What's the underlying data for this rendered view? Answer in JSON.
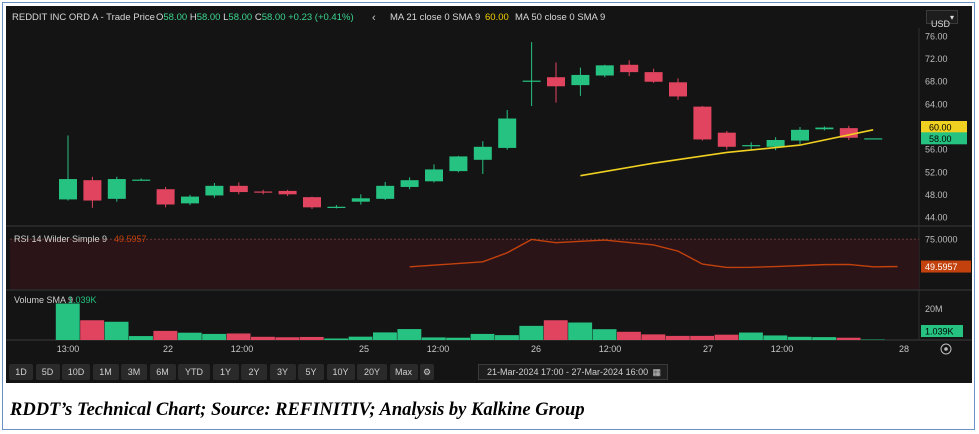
{
  "header": {
    "instrument": "REDDIT INC ORD A - Trade Price",
    "o_label": "O",
    "o_value": "58.00",
    "h_label": "H",
    "h_value": "58.00",
    "l_label": "L",
    "l_value": "58.00",
    "c_label": "C",
    "c_value": "58.00",
    "change": "+0.23 (+0.41%)",
    "chevron": "‹",
    "ma_label": "MA 21 close 0 SMA 9",
    "ma_value": "60.00",
    "ma50_label": "MA 50 close 0 SMA 9",
    "currency": "USD"
  },
  "colors": {
    "up": "#26c281",
    "down": "#e0445f",
    "ma": "#f0d020",
    "rsi": "#c2410c",
    "background": "#141414"
  },
  "chart_data": {
    "type": "candlestick",
    "price_axis": {
      "ticks": [
        "76.00",
        "72.00",
        "68.00",
        "64.00",
        "60.00",
        "56.00",
        "52.00",
        "48.00",
        "44.00"
      ],
      "ylim": [
        42.5,
        77.5
      ]
    },
    "price_badges": [
      {
        "label": "60.00",
        "value": 60.0,
        "color": "#f0d020"
      },
      {
        "label": "58.00",
        "value": 58.0,
        "color": "#26c281"
      }
    ],
    "time_labels": [
      "13:00",
      "22",
      "12:00",
      "25",
      "12:00",
      "26",
      "12:00",
      "27",
      "12:00",
      "28"
    ],
    "candles": [
      {
        "o": 47.2,
        "h": 58.5,
        "l": 47.0,
        "c": 50.8
      },
      {
        "o": 50.6,
        "h": 51.2,
        "l": 45.7,
        "c": 47.0
      },
      {
        "o": 47.3,
        "h": 51.2,
        "l": 46.8,
        "c": 50.8
      },
      {
        "o": 50.7,
        "h": 50.9,
        "l": 50.5,
        "c": 50.7
      },
      {
        "o": 49.0,
        "h": 49.4,
        "l": 45.8,
        "c": 46.3
      },
      {
        "o": 46.5,
        "h": 48.0,
        "l": 46.2,
        "c": 47.7
      },
      {
        "o": 47.9,
        "h": 50.1,
        "l": 47.5,
        "c": 49.6
      },
      {
        "o": 49.6,
        "h": 50.2,
        "l": 48.1,
        "c": 48.5
      },
      {
        "o": 48.6,
        "h": 48.9,
        "l": 48.1,
        "c": 48.4
      },
      {
        "o": 48.7,
        "h": 48.9,
        "l": 47.8,
        "c": 48.1
      },
      {
        "o": 47.6,
        "h": 47.7,
        "l": 45.5,
        "c": 45.8
      },
      {
        "o": 45.9,
        "h": 46.2,
        "l": 45.6,
        "c": 45.9
      },
      {
        "o": 46.8,
        "h": 48.1,
        "l": 46.3,
        "c": 47.4
      },
      {
        "o": 47.3,
        "h": 50.3,
        "l": 47.1,
        "c": 49.6
      },
      {
        "o": 49.4,
        "h": 51.1,
        "l": 49.0,
        "c": 50.6
      },
      {
        "o": 50.4,
        "h": 53.4,
        "l": 50.2,
        "c": 52.5
      },
      {
        "o": 52.2,
        "h": 54.9,
        "l": 52.0,
        "c": 54.8
      },
      {
        "o": 54.2,
        "h": 57.5,
        "l": 51.7,
        "c": 56.5
      },
      {
        "o": 56.3,
        "h": 63.0,
        "l": 56.0,
        "c": 61.5
      },
      {
        "o": 68.0,
        "h": 75.0,
        "l": 63.7,
        "c": 68.2
      },
      {
        "o": 68.8,
        "h": 71.4,
        "l": 64.3,
        "c": 67.2
      },
      {
        "o": 67.4,
        "h": 70.5,
        "l": 65.5,
        "c": 69.2
      },
      {
        "o": 69.1,
        "h": 71.0,
        "l": 68.8,
        "c": 70.9
      },
      {
        "o": 71.0,
        "h": 71.8,
        "l": 69.0,
        "c": 69.7
      },
      {
        "o": 69.7,
        "h": 70.3,
        "l": 67.8,
        "c": 68.0
      },
      {
        "o": 67.9,
        "h": 68.6,
        "l": 64.8,
        "c": 65.4
      },
      {
        "o": 63.6,
        "h": 63.7,
        "l": 57.6,
        "c": 57.8
      },
      {
        "o": 59.0,
        "h": 59.3,
        "l": 56.0,
        "c": 56.5
      },
      {
        "o": 56.6,
        "h": 57.3,
        "l": 56.0,
        "c": 56.8
      },
      {
        "o": 56.5,
        "h": 58.2,
        "l": 55.9,
        "c": 57.7
      },
      {
        "o": 57.6,
        "h": 60.0,
        "l": 57.0,
        "c": 59.5
      },
      {
        "o": 59.6,
        "h": 60.1,
        "l": 59.4,
        "c": 59.9
      },
      {
        "o": 59.8,
        "h": 60.2,
        "l": 57.7,
        "c": 58.1
      },
      {
        "o": 58.0,
        "h": 58.0,
        "l": 58.0,
        "c": 58.0
      }
    ],
    "ma_line": [
      [
        21,
        51.4
      ],
      [
        24,
        53.6
      ],
      [
        27,
        55.5
      ],
      [
        30,
        56.8
      ],
      [
        33,
        59.5
      ]
    ],
    "rsi": {
      "label": "RSI 14 Wilder Simple 9",
      "value": "49.5957",
      "axis_label": "75.0000",
      "overbought": 75,
      "points": [
        [
          14,
          50.6
        ],
        [
          17,
          55.0
        ],
        [
          18,
          63.0
        ],
        [
          19,
          74.8
        ],
        [
          20,
          72.0
        ],
        [
          21,
          73.2
        ],
        [
          22,
          74.3
        ],
        [
          24,
          70.0
        ],
        [
          25,
          64.5
        ],
        [
          26,
          53.0
        ],
        [
          27,
          50.0
        ],
        [
          28,
          50.1
        ],
        [
          29,
          50.8
        ],
        [
          31,
          52.5
        ],
        [
          32,
          52.7
        ],
        [
          33,
          50.6
        ],
        [
          34,
          50.8
        ]
      ]
    },
    "volume": {
      "label": "Volume SMA 9",
      "sma_value": "1.039K",
      "axis_label": "20M",
      "badge": "1.039K",
      "bars": [
        24.0,
        13.0,
        12.0,
        2.6,
        6.0,
        4.8,
        4.0,
        4.3,
        2.1,
        1.8,
        2.0,
        1.0,
        2.2,
        5.0,
        7.2,
        1.7,
        1.5,
        4.0,
        3.2,
        9.3,
        13.0,
        11.5,
        7.1,
        5.4,
        3.7,
        2.7,
        2.7,
        3.5,
        4.9,
        3.0,
        2.1,
        1.9,
        1.5,
        0.3
      ]
    }
  },
  "timeframes": [
    "1D",
    "5D",
    "10D",
    "1M",
    "3M",
    "6M",
    "YTD",
    "1Y",
    "2Y",
    "3Y",
    "5Y",
    "10Y",
    "20Y",
    "Max"
  ],
  "date_range": "21-Mar-2024 17:00  -  27-Mar-2024 16:00",
  "caption": "RDDT’s Technical Chart; Source: REFINITIV; Analysis by Kalkine Group"
}
